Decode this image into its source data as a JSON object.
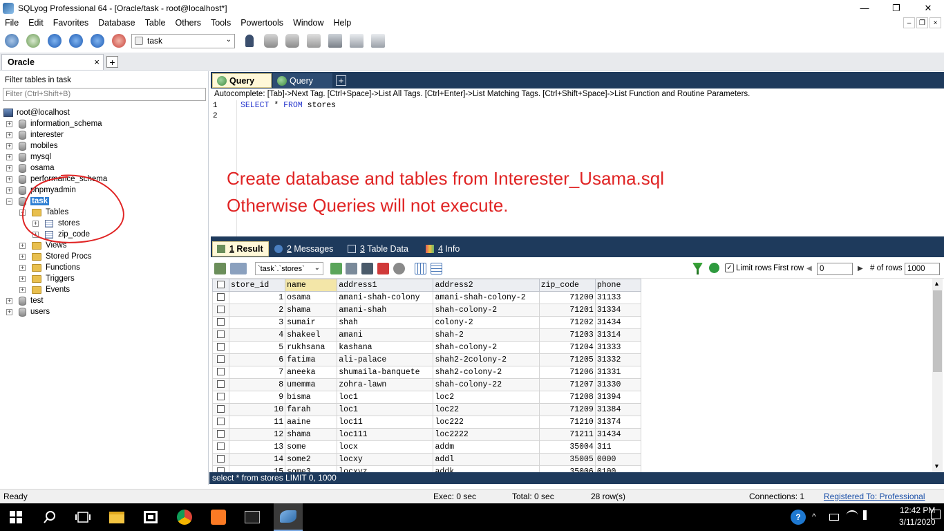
{
  "window": {
    "title": "SQLyog Professional 64 - [Oracle/task - root@localhost*]",
    "min": "—",
    "max": "❐",
    "close": "✕"
  },
  "menu": [
    "File",
    "Edit",
    "Favorites",
    "Database",
    "Table",
    "Others",
    "Tools",
    "Powertools",
    "Window",
    "Help"
  ],
  "mdi_controls": [
    "–",
    "❐",
    "×"
  ],
  "toolbar": {
    "database_select": "task",
    "dropdown_arrow": "⌄"
  },
  "connection_tab": {
    "label": "Oracle",
    "close": "×",
    "add": "+"
  },
  "object_browser": {
    "filter_label": "Filter tables in task",
    "filter_placeholder": "Filter (Ctrl+Shift+B)",
    "root": "root@localhost",
    "databases": [
      "information_schema",
      "interester",
      "mobiles",
      "mysql",
      "osama",
      "performance_schema",
      "phpmyadmin",
      "task",
      "test",
      "users"
    ],
    "task_children": {
      "tables_label": "Tables",
      "tables": [
        "stores",
        "zip_code"
      ],
      "folders": [
        "Views",
        "Stored Procs",
        "Functions",
        "Triggers",
        "Events"
      ]
    },
    "expand": "+",
    "collapse": "−"
  },
  "query_tabs": [
    "Query",
    "Query"
  ],
  "query_add": "+",
  "autocomplete_hint": "Autocomplete: [Tab]->Next Tag. [Ctrl+Space]->List All Tags. [Ctrl+Enter]->List Matching Tags. [Ctrl+Shift+Space]->List Function and Routine Parameters.",
  "editor": {
    "line_numbers": [
      "1",
      "2"
    ],
    "sql_kw1": "SELECT",
    "sql_star": " * ",
    "sql_kw2": "FROM",
    "sql_table": " stores"
  },
  "notice": {
    "line1": "Create database and tables from Interester_Usama.sql",
    "line2": "Otherwise Queries will not execute."
  },
  "result_tabs": [
    {
      "num": "1",
      "label": " Result"
    },
    {
      "num": "2",
      "label": " Messages"
    },
    {
      "num": "3",
      "label": " Table Data"
    },
    {
      "num": "4",
      "label": " Info"
    }
  ],
  "result_toolbar": {
    "table_select": "`task`.`stores`",
    "limit_rows_label": "Limit rows",
    "first_row_label": "First row",
    "first_row_value": "0",
    "num_rows_label": "# of rows",
    "num_rows_value": "1000",
    "prev": "◀",
    "next": "▶"
  },
  "grid": {
    "columns": [
      "store_id",
      "name",
      "address1",
      "address2",
      "zip_code",
      "phone"
    ],
    "rows": [
      [
        "1",
        "osama",
        "amani-shah-colony",
        "amani-shah-colony-2",
        "71200",
        "31133"
      ],
      [
        "2",
        "shama",
        "amani-shah",
        "shah-colony-2",
        "71201",
        "31334"
      ],
      [
        "3",
        "sumair",
        "shah",
        "colony-2",
        "71202",
        "31434"
      ],
      [
        "4",
        "shakeel",
        "amani",
        "shah-2",
        "71203",
        "31314"
      ],
      [
        "5",
        "rukhsana",
        "kashana",
        "shah-colony-2",
        "71204",
        "31333"
      ],
      [
        "6",
        "fatima",
        "ali-palace",
        "shah2-2colony-2",
        "71205",
        "31332"
      ],
      [
        "7",
        "aneeka",
        "shumaila-banquete",
        "shah2-colony-2",
        "71206",
        "31331"
      ],
      [
        "8",
        "umemma",
        "zohra-lawn",
        "shah-colony-22",
        "71207",
        "31330"
      ],
      [
        "9",
        "bisma",
        "loc1",
        "loc2",
        "71208",
        "31394"
      ],
      [
        "10",
        "farah",
        "loc1",
        "loc22",
        "71209",
        "31384"
      ],
      [
        "11",
        "aaine",
        "loc11",
        "loc222",
        "71210",
        "31374"
      ],
      [
        "12",
        "shama",
        "loc111",
        "loc2222",
        "71211",
        "31434"
      ],
      [
        "13",
        "some",
        "locx",
        "addm",
        "35004",
        "311"
      ],
      [
        "14",
        "some2",
        "locxy",
        "addl",
        "35005",
        "0000"
      ],
      [
        "15",
        "some3",
        "locxyz",
        "addk",
        "35006",
        "0100"
      ]
    ]
  },
  "scroll": {
    "up": "▲",
    "down": "▼"
  },
  "sql_footer": "select * from stores LIMIT 0, 1000",
  "status": {
    "ready": "Ready",
    "exec": "Exec: 0 sec",
    "total": "Total: 0 sec",
    "rows": "28 row(s)",
    "connections": "Connections: 1",
    "registered": "Registered To: Professional"
  },
  "taskbar": {
    "time": "12:42 PM",
    "date": "3/11/2020"
  },
  "colors": {
    "dark_navy": "#1e3a5c",
    "active_tab": "#fff8d8",
    "notice_red": "#e02424",
    "selection_blue": "#2f7fd3"
  }
}
